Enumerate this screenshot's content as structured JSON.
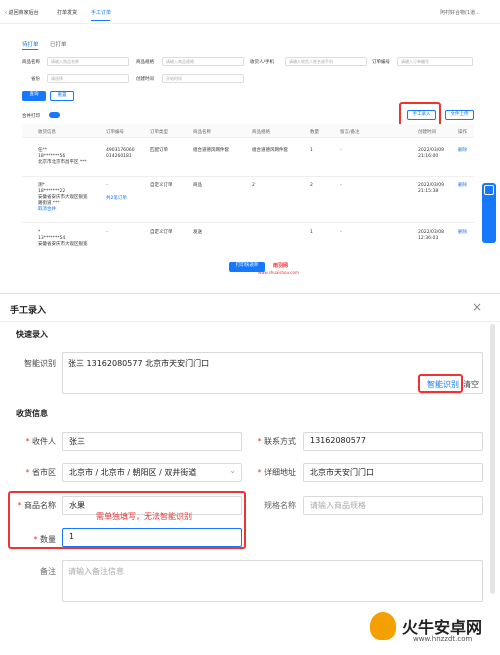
{
  "nav": {
    "back": "返回商家后台",
    "items": [
      "打单发货",
      "手工订单"
    ],
    "shop": "阿村好合物(1道..."
  },
  "tabs": [
    "待打单",
    "已打单"
  ],
  "filters": {
    "row1": [
      {
        "label": "商品名称",
        "ph": "请输入商品名称"
      },
      {
        "label": "商品规格",
        "ph": "请输入商品规格"
      },
      {
        "label": "收货人/手机",
        "ph": "请输入收货人姓名或手机"
      },
      {
        "label": "订单编号",
        "ph": "请输入订单编号"
      }
    ],
    "row2": [
      {
        "label": "省份",
        "ph": "请选择"
      },
      {
        "label": "创建时间",
        "ph": "开始时间"
      }
    ],
    "search": "查询",
    "reset": "重置"
  },
  "merge_print": "合并打印",
  "btn_manual": "手工录入",
  "btn_upload": "文件上传",
  "table": {
    "headers": [
      "收货信息",
      "订单编号",
      "订单类型",
      "商品名称",
      "商品规格",
      "数量",
      "留言/备注",
      "创建时间",
      "操作"
    ],
    "rows": [
      {
        "recv": [
          "任**",
          "18*******56",
          "北京市北京市昌平区 ***"
        ],
        "order": [
          "4903176060",
          "014260181"
        ],
        "type": "匹配订单",
        "name": "组合道德风网件套",
        "spec": "组合道德风网件套",
        "qty": "1",
        "memo": "-",
        "time": [
          "2022/03/09",
          "21:16:00"
        ],
        "op": "删除",
        "extra": ""
      },
      {
        "recv": [
          "测*",
          "18*******22",
          "安徽省安庆市大观区银宽",
          "路街道 ***"
        ],
        "order": [
          "-"
        ],
        "type": "自定义订单",
        "name": "商品",
        "spec": "2",
        "qty": "2",
        "memo": "-",
        "time": [
          "2022/03/09",
          "21:15:38"
        ],
        "op": "删除",
        "extra": "共2笔订单",
        "link": "取消合并"
      },
      {
        "recv": [
          "*",
          "13*******54",
          "安徽省安庆市大观区银宽",
          "路街道 ***"
        ],
        "order": [
          "-"
        ],
        "type": "自定义订单",
        "name": "发送",
        "spec": "",
        "qty": "1",
        "memo": "-",
        "time": [
          "2022/03/08",
          "12:36:03"
        ],
        "op": "删除",
        "extra": ""
      }
    ]
  },
  "print_btn": "打印快递单",
  "watermark": [
    "雨羽网",
    "www.shuaishou.com"
  ],
  "modal": {
    "title": "手工录入",
    "quick": "快速录入",
    "smart_label": "智能识别",
    "smart_text": "张三 13162080577 北京市天安门门口",
    "smart_btn": "智能识别",
    "clear": "清空",
    "recv_section": "收货信息",
    "receiver_label": "收件人",
    "receiver": "张三",
    "phone_label": "联系方式",
    "phone": "13162080577",
    "region_label": "省市区",
    "region": "北京市 / 北京市 / 朝阳区 / 双井街道",
    "addr_label": "详细地址",
    "addr": "北京市天安门门口",
    "goods_label": "商品名称",
    "goods": "水果",
    "spec_label": "规格名称",
    "spec_ph": "请输入商品规格",
    "qty_label": "数量",
    "qty": "1",
    "note_label": "备注",
    "note_ph": "请输入备注信息",
    "annotation": "需单独填写，无法智能识别"
  },
  "brand": {
    "name": "火牛安卓网",
    "url": "www.hnzzdt.com"
  }
}
